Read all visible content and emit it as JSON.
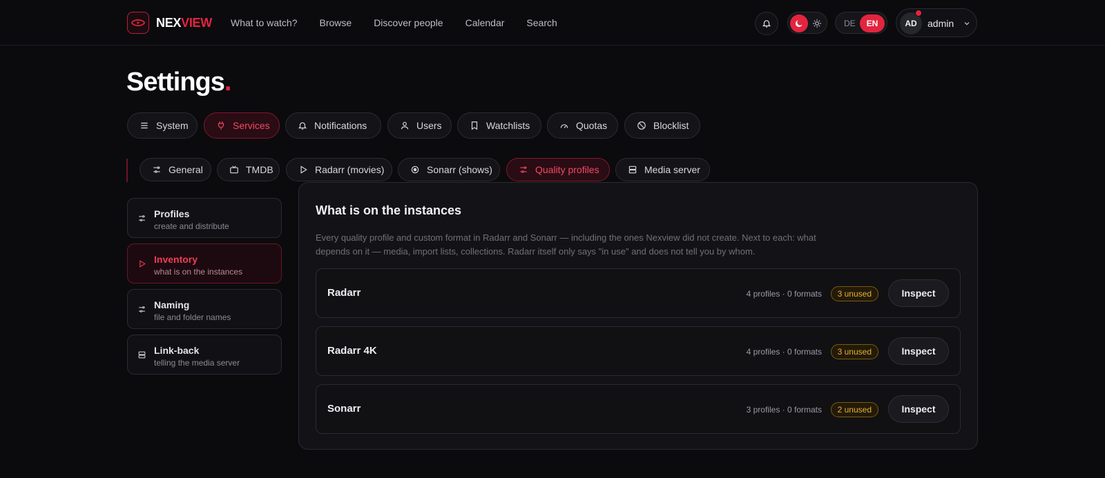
{
  "brand": {
    "part1": "NEX",
    "part2": "VIEW"
  },
  "nav": [
    "What to watch?",
    "Browse",
    "Discover people",
    "Calendar",
    "Search"
  ],
  "lang": {
    "de": "DE",
    "en": "EN"
  },
  "user": {
    "initials": "AD",
    "name": "admin"
  },
  "page": {
    "title": "Settings",
    "dot": "."
  },
  "tabs": [
    "System",
    "Services",
    "Notifications",
    "Users",
    "Watchlists",
    "Quotas",
    "Blocklist"
  ],
  "subtabs": [
    "General",
    "TMDB",
    "Radarr (movies)",
    "Sonarr (shows)",
    "Quality profiles",
    "Media server"
  ],
  "side": [
    {
      "title": "Profiles",
      "sub": "create and distribute"
    },
    {
      "title": "Inventory",
      "sub": "what is on the instances"
    },
    {
      "title": "Naming",
      "sub": "file and folder names"
    },
    {
      "title": "Link-back",
      "sub": "telling the media server"
    }
  ],
  "card": {
    "title": "What is on the instances",
    "desc": "Every quality profile and custom format in Radarr and Sonarr — including the ones Nexview did not create. Next to each: what depends on it — media, import lists, collections. Radarr itself only says \"in use\" and does not tell you by whom.",
    "rows": [
      {
        "name": "Radarr",
        "meta": "4 profiles · 0 formats",
        "badge": "3 unused",
        "action": "Inspect"
      },
      {
        "name": "Radarr 4K",
        "meta": "4 profiles · 0 formats",
        "badge": "3 unused",
        "action": "Inspect"
      },
      {
        "name": "Sonarr",
        "meta": "3 profiles · 0 formats",
        "badge": "2 unused",
        "action": "Inspect"
      }
    ]
  },
  "colors": {
    "accent": "#e3243f",
    "badge": "#e3b13a",
    "background": "#0b0b0e"
  }
}
